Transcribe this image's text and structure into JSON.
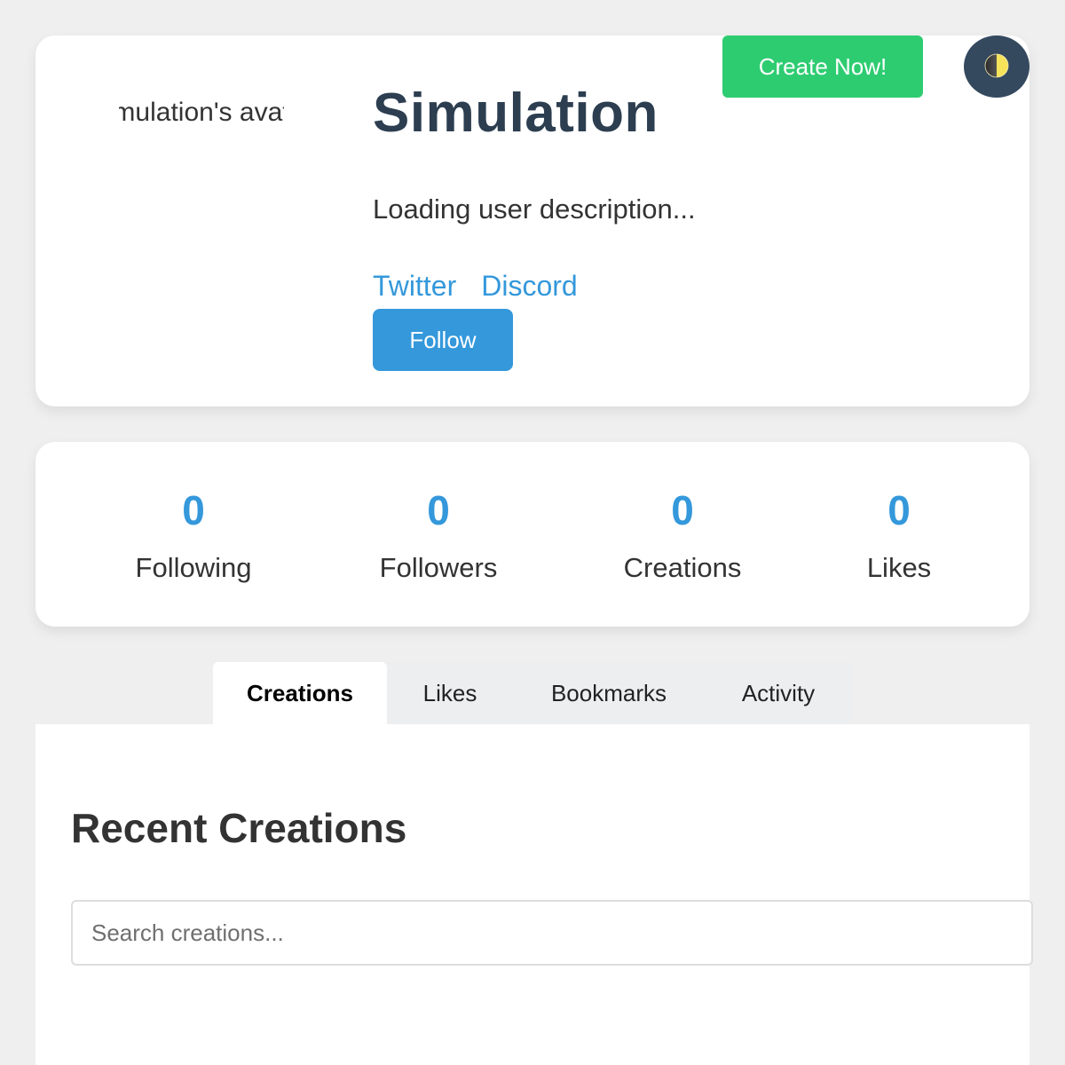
{
  "profile": {
    "avatar_alt": "Simulation's avatar",
    "username": "Simulation",
    "description": "Loading user description...",
    "social_links": [
      "Twitter",
      "Discord"
    ],
    "follow_label": "Follow"
  },
  "header": {
    "create_label": "Create Now!",
    "theme_icon": "half-moon-icon"
  },
  "stats": [
    {
      "value": "0",
      "label": "Following"
    },
    {
      "value": "0",
      "label": "Followers"
    },
    {
      "value": "0",
      "label": "Creations"
    },
    {
      "value": "0",
      "label": "Likes"
    }
  ],
  "tabs": [
    {
      "label": "Creations",
      "active": true
    },
    {
      "label": "Likes",
      "active": false
    },
    {
      "label": "Bookmarks",
      "active": false
    },
    {
      "label": "Activity",
      "active": false
    }
  ],
  "content": {
    "section_title": "Recent Creations",
    "search_placeholder": "Search creations..."
  },
  "colors": {
    "primary": "#3498db",
    "create": "#2ecc71",
    "dark": "#2c3e50",
    "toggle": "#34495e"
  }
}
